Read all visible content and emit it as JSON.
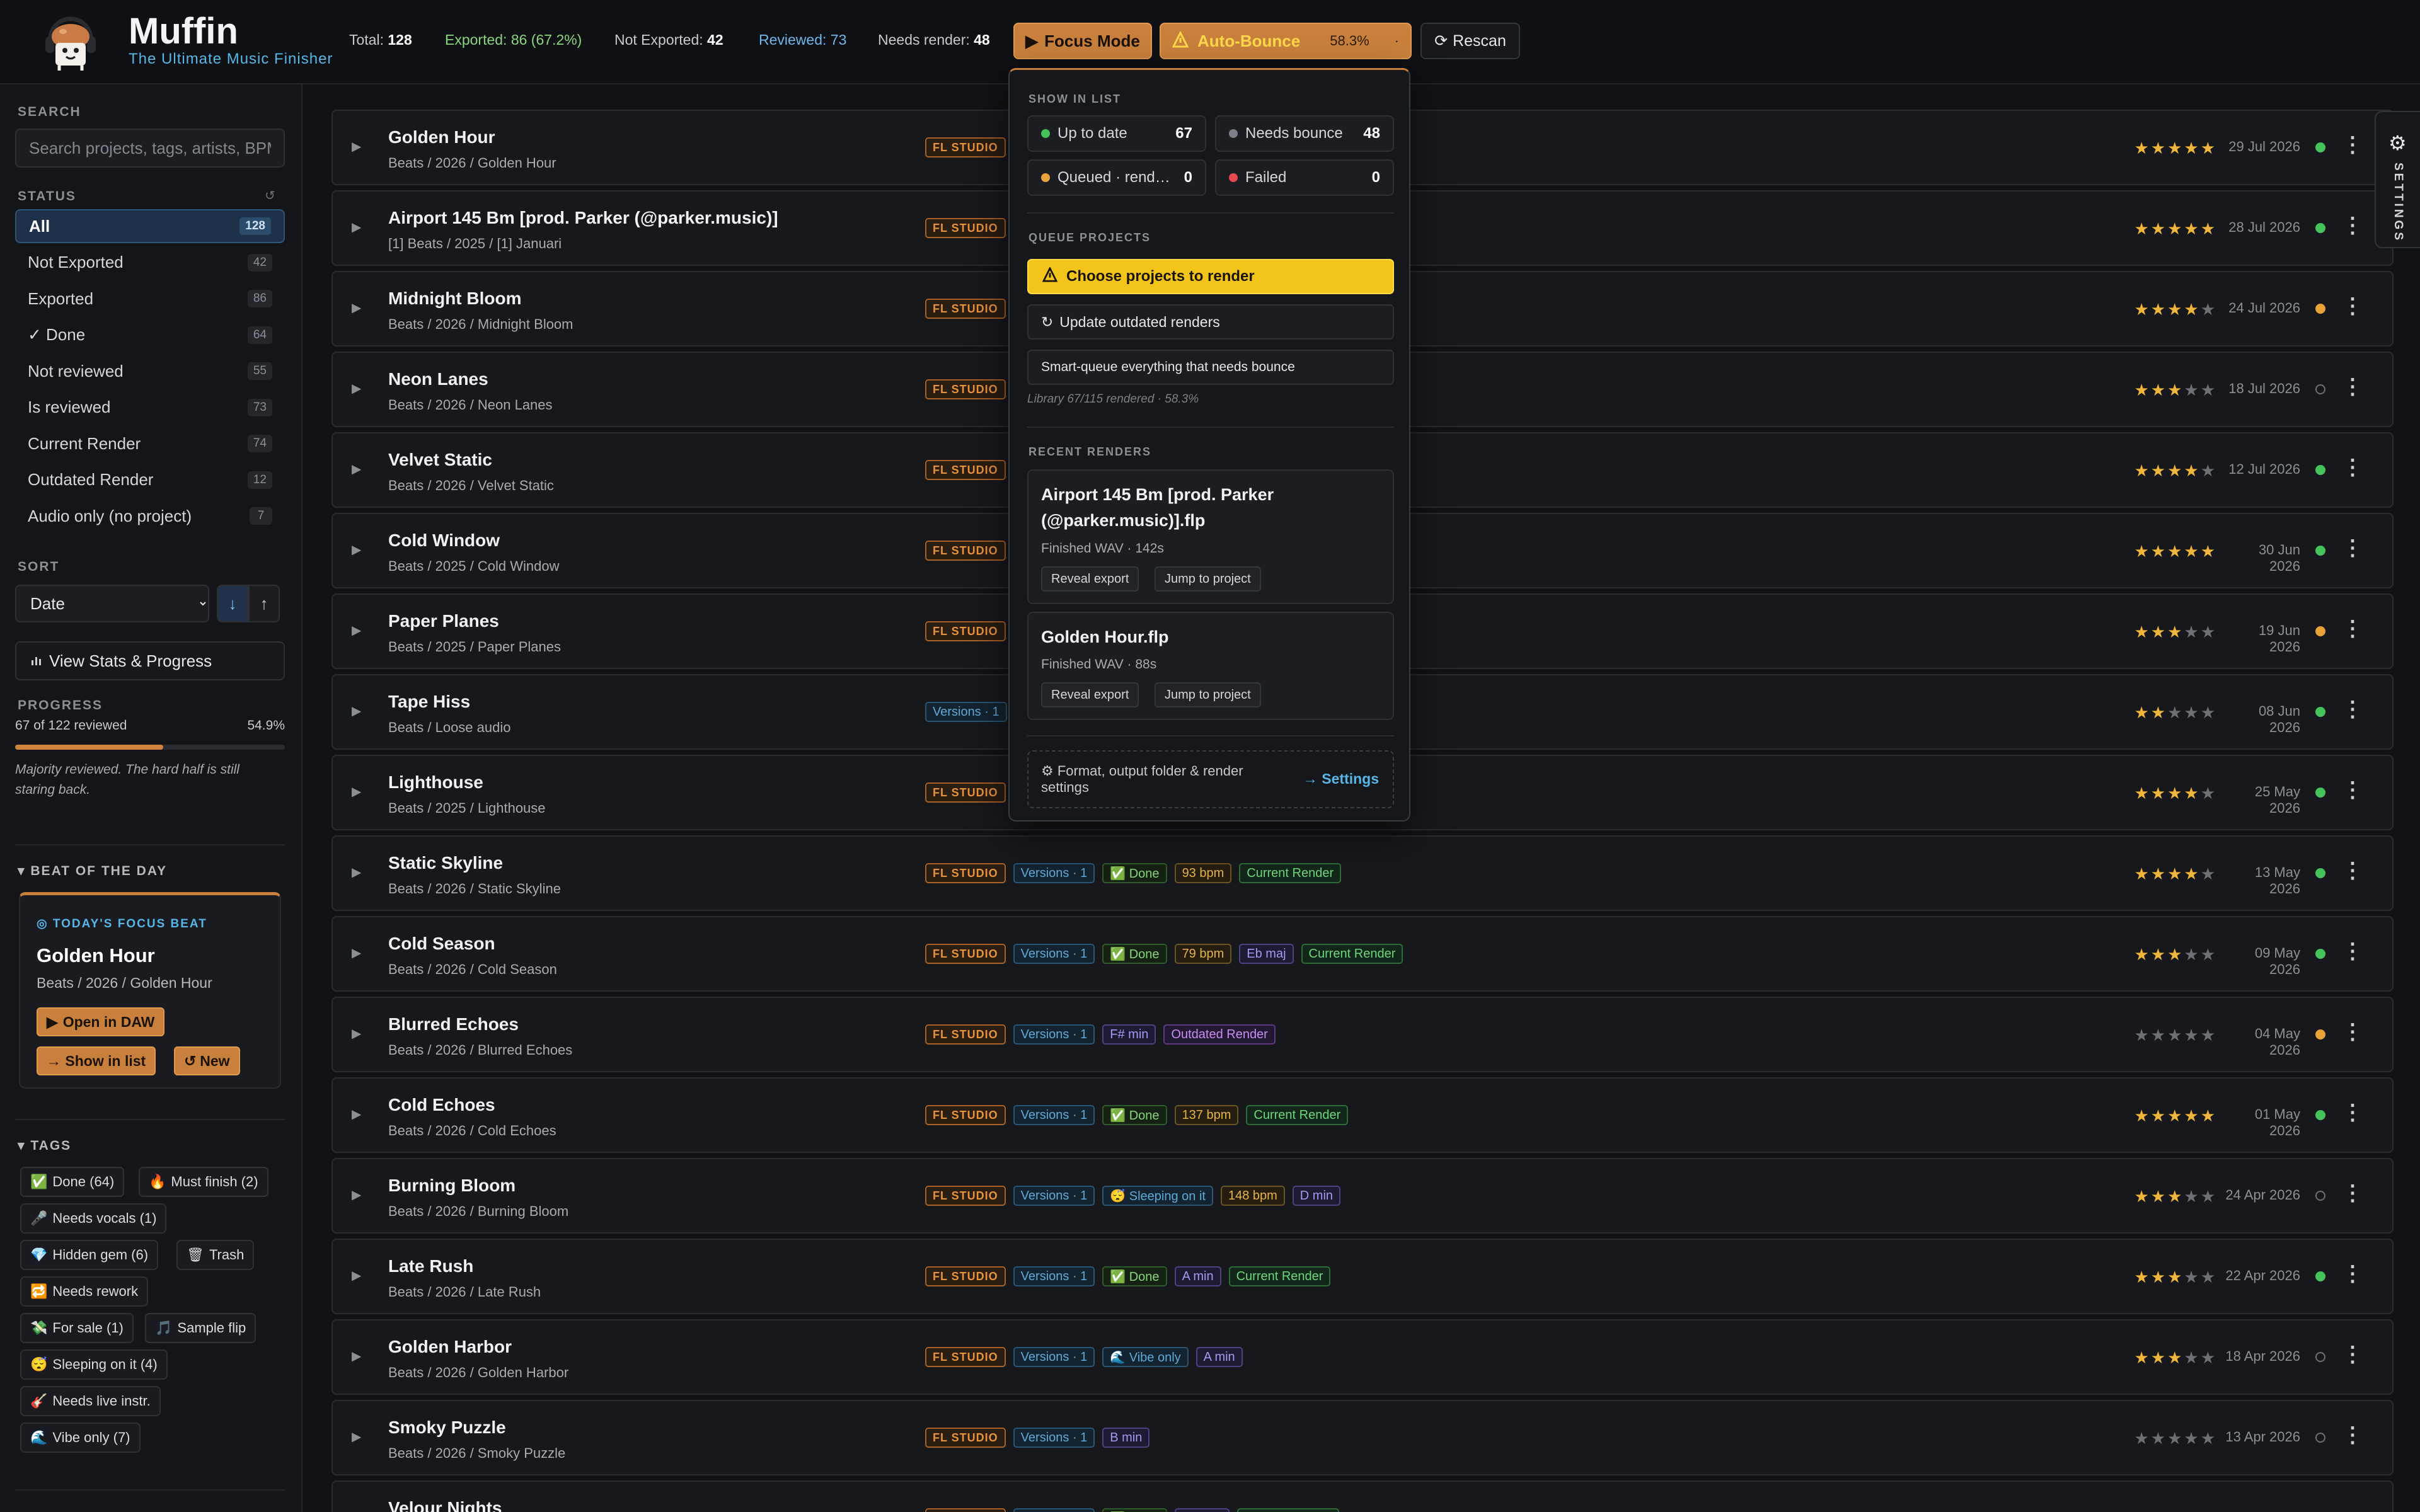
{
  "app": {
    "name": "Muffin",
    "tagline": "The Ultimate Music Finisher"
  },
  "header": {
    "stats": [
      {
        "label": "Total:",
        "value": "128",
        "tone": "default"
      },
      {
        "label": "Exported: 86 (67.2%)",
        "value": "",
        "tone": "green"
      },
      {
        "label": "Not Exported:",
        "value": "42",
        "tone": "default"
      },
      {
        "label": "Reviewed: 73",
        "value": "",
        "tone": "blue"
      },
      {
        "label": "Needs render:",
        "value": "48",
        "tone": "default"
      }
    ],
    "focus_mode_label": "Focus Mode",
    "auto_bounce_label": "Auto-Bounce",
    "auto_bounce_pct": "58.3%",
    "auto_bounce_dot": "·",
    "rescan_label": "Rescan"
  },
  "sidebar": {
    "search_label": "SEARCH",
    "search_placeholder": "Search projects, tags, artists, BPM",
    "status_label": "STATUS",
    "status_items": [
      {
        "label": "All",
        "count": "128",
        "active": true
      },
      {
        "label": "Not Exported",
        "count": "42"
      },
      {
        "label": "Exported",
        "count": "86"
      },
      {
        "label": "✓ Done",
        "count": "64"
      },
      {
        "label": "Not reviewed",
        "count": "55"
      },
      {
        "label": "Is reviewed",
        "count": "73"
      },
      {
        "label": "Current Render",
        "count": "74"
      },
      {
        "label": "Outdated Render",
        "count": "12"
      },
      {
        "label": "Audio only (no project)",
        "count": "7"
      }
    ],
    "sort_label": "SORT",
    "sort_value": "Date",
    "sort_options": [
      "Date"
    ],
    "sort_down": "↓",
    "sort_up": "↑",
    "view_stats_label": "View Stats & Progress",
    "progress_label": "PROGRESS",
    "progress_text": "67 of 122 reviewed",
    "progress_pct_text": "54.9%",
    "progress_value": 0.549,
    "progress_note": "Majority reviewed. The hard half is still staring back.",
    "beat_of_day_label": "BEAT OF THE DAY",
    "beat": {
      "focus_label": "TODAY'S FOCUS BEAT",
      "title": "Golden Hour",
      "path": "Beats / 2026 / Golden Hour",
      "open_daw": "Open in DAW",
      "show_in_list": "→ Show in list",
      "new_label": "New"
    },
    "tags_label": "TAGS",
    "tags": [
      {
        "icon": "✅",
        "label": "Done (64)"
      },
      {
        "icon": "🔥",
        "label": "Must finish (2)"
      },
      {
        "icon": "🎤",
        "label": "Needs vocals (1)"
      },
      {
        "icon": "💎",
        "label": "Hidden gem (6)"
      },
      {
        "icon": "🗑",
        "label": "Trash"
      },
      {
        "icon": "🔁",
        "label": "Needs rework"
      },
      {
        "icon": "💸",
        "label": "For sale (1)"
      },
      {
        "icon": "🎵",
        "label": "Sample flip"
      },
      {
        "icon": "😴",
        "label": "Sleeping on it (4)"
      },
      {
        "icon": "🎸",
        "label": "Needs live instr."
      },
      {
        "icon": "🌊",
        "label": "Vibe only (7)"
      }
    ]
  },
  "rows": [
    {
      "title": "Golden Hour",
      "path": "Beats / 2026 / Golden Hour",
      "chips": [
        {
          "t": "FL STUDIO",
          "k": "fl"
        }
      ],
      "stars": 5,
      "date": "29 Jul 2026",
      "dot": "green"
    },
    {
      "title": "Airport 145 Bm [prod. Parker (@parker.music)]",
      "path": "[1] Beats / 2025 / [1] Januari",
      "chips": [
        {
          "t": "FL STUDIO",
          "k": "fl"
        }
      ],
      "stars": 5,
      "date": "28 Jul 2026",
      "dot": "green"
    },
    {
      "title": "Midnight Bloom",
      "path": "Beats / 2026 / Midnight Bloom",
      "chips": [
        {
          "t": "FL STUDIO",
          "k": "fl"
        }
      ],
      "stars": 4,
      "date": "24 Jul 2026",
      "dot": "orange"
    },
    {
      "title": "Neon Lanes",
      "path": "Beats / 2026 / Neon Lanes",
      "chips": [
        {
          "t": "FL STUDIO",
          "k": "fl"
        }
      ],
      "stars": 3,
      "date": "18 Jul 2026",
      "dot": "empty"
    },
    {
      "title": "Velvet Static",
      "path": "Beats / 2026 / Velvet Static",
      "chips": [
        {
          "t": "FL STUDIO",
          "k": "fl"
        }
      ],
      "stars": 4,
      "date": "12 Jul 2026",
      "dot": "green"
    },
    {
      "title": "Cold Window",
      "path": "Beats / 2025 / Cold Window",
      "chips": [
        {
          "t": "FL STUDIO",
          "k": "fl"
        }
      ],
      "stars": 5,
      "date": "30 Jun 2026",
      "dot": "green"
    },
    {
      "title": "Paper Planes",
      "path": "Beats / 2025 / Paper Planes",
      "chips": [
        {
          "t": "FL STUDIO",
          "k": "fl"
        }
      ],
      "stars": 3,
      "date": "19 Jun 2026",
      "dot": "orange"
    },
    {
      "title": "Tape Hiss",
      "path": "Beats / Loose audio",
      "chips": [
        {
          "t": "Versions · 1",
          "k": "ver"
        }
      ],
      "stars": 2,
      "date": "08 Jun 2026",
      "dot": "green"
    },
    {
      "title": "Lighthouse",
      "path": "Beats / 2025 / Lighthouse",
      "chips": [
        {
          "t": "FL STUDIO",
          "k": "fl"
        }
      ],
      "stars": 4,
      "date": "25 May 2026",
      "dot": "green"
    },
    {
      "title": "Static Skyline",
      "path": "Beats / 2026 / Static Skyline",
      "chips": [
        {
          "t": "FL STUDIO",
          "k": "fl"
        },
        {
          "t": "Versions · 1",
          "k": "ver"
        },
        {
          "t": "✅ Done",
          "k": "done"
        },
        {
          "t": "93 bpm",
          "k": "bpm"
        },
        {
          "t": "Current Render",
          "k": "cur"
        }
      ],
      "stars": 4,
      "date": "13 May 2026",
      "dot": "green"
    },
    {
      "title": "Cold Season",
      "path": "Beats / 2026 / Cold Season",
      "chips": [
        {
          "t": "FL STUDIO",
          "k": "fl"
        },
        {
          "t": "Versions · 1",
          "k": "ver"
        },
        {
          "t": "✅ Done",
          "k": "done"
        },
        {
          "t": "79 bpm",
          "k": "bpm"
        },
        {
          "t": "Eb maj",
          "k": "key"
        },
        {
          "t": "Current Render",
          "k": "cur"
        }
      ],
      "stars": 3,
      "date": "09 May 2026",
      "dot": "green"
    },
    {
      "title": "Blurred Echoes",
      "path": "Beats / 2026 / Blurred Echoes",
      "chips": [
        {
          "t": "FL STUDIO",
          "k": "fl"
        },
        {
          "t": "Versions · 1",
          "k": "ver"
        },
        {
          "t": "F# min",
          "k": "key"
        },
        {
          "t": "Outdated Render",
          "k": "out"
        }
      ],
      "stars": 0,
      "date": "04 May 2026",
      "dot": "orange"
    },
    {
      "title": "Cold Echoes",
      "path": "Beats / 2026 / Cold Echoes",
      "chips": [
        {
          "t": "FL STUDIO",
          "k": "fl"
        },
        {
          "t": "Versions · 1",
          "k": "ver"
        },
        {
          "t": "✅ Done",
          "k": "done"
        },
        {
          "t": "137 bpm",
          "k": "bpm"
        },
        {
          "t": "Current Render",
          "k": "cur"
        }
      ],
      "stars": 5,
      "date": "01 May 2026",
      "dot": "green"
    },
    {
      "title": "Burning Bloom",
      "path": "Beats / 2026 / Burning Bloom",
      "chips": [
        {
          "t": "FL STUDIO",
          "k": "fl"
        },
        {
          "t": "Versions · 1",
          "k": "ver"
        },
        {
          "t": "😴 Sleeping on it",
          "k": "sleep"
        },
        {
          "t": "148 bpm",
          "k": "bpm"
        },
        {
          "t": "D min",
          "k": "key"
        }
      ],
      "stars": 3,
      "date": "24 Apr 2026",
      "dot": "empty"
    },
    {
      "title": "Late Rush",
      "path": "Beats / 2026 / Late Rush",
      "chips": [
        {
          "t": "FL STUDIO",
          "k": "fl"
        },
        {
          "t": "Versions · 1",
          "k": "ver"
        },
        {
          "t": "✅ Done",
          "k": "done"
        },
        {
          "t": "A min",
          "k": "key"
        },
        {
          "t": "Current Render",
          "k": "cur"
        }
      ],
      "stars": 3,
      "date": "22 Apr 2026",
      "dot": "green"
    },
    {
      "title": "Golden Harbor",
      "path": "Beats / 2026 / Golden Harbor",
      "chips": [
        {
          "t": "FL STUDIO",
          "k": "fl"
        },
        {
          "t": "Versions · 1",
          "k": "ver"
        },
        {
          "t": "🌊 Vibe only",
          "k": "vibe"
        },
        {
          "t": "A min",
          "k": "key"
        }
      ],
      "stars": 3,
      "date": "18 Apr 2026",
      "dot": "empty"
    },
    {
      "title": "Smoky Puzzle",
      "path": "Beats / 2026 / Smoky Puzzle",
      "chips": [
        {
          "t": "FL STUDIO",
          "k": "fl"
        },
        {
          "t": "Versions · 1",
          "k": "ver"
        },
        {
          "t": "B min",
          "k": "key"
        }
      ],
      "stars": 0,
      "date": "13 Apr 2026",
      "dot": "empty"
    },
    {
      "title": "Velour Nights",
      "path": "",
      "chips": [
        {
          "t": "FL STUDIO",
          "k": "fl"
        },
        {
          "t": "Versions · 1",
          "k": "ver"
        },
        {
          "t": "✅ Done",
          "k": "done"
        },
        {
          "t": "C# min",
          "k": "key"
        },
        {
          "t": "Current Render",
          "k": "cur"
        }
      ],
      "stars": 0,
      "date": "",
      "dot": ""
    }
  ],
  "settings_tab_label": "SETTINGS",
  "dropdown": {
    "show_in_list_label": "SHOW IN LIST",
    "stats": [
      {
        "label": "Up to date",
        "value": "67",
        "color": "#46c25a"
      },
      {
        "label": "Needs bounce",
        "value": "48",
        "color": "#7d7f86"
      },
      {
        "label": "Queued · rendering",
        "value": "0",
        "color": "#e8a23a"
      },
      {
        "label": "Failed",
        "value": "0",
        "color": "#e5484d"
      }
    ],
    "queue_label": "QUEUE PROJECTS",
    "choose_label": "Choose projects to render",
    "update_label": "Update outdated renders",
    "smart_label": "Smart-queue everything that needs bounce",
    "library_note": "Library 67/115 rendered · 58.3%",
    "recent_label": "RECENT RENDERS",
    "recent": [
      {
        "title": "Airport 145 Bm [prod. Parker (@parker.music)].flp",
        "meta": "Finished   WAV · 142s",
        "reveal": "Reveal export",
        "jump": "Jump to project"
      },
      {
        "title": "Golden Hour.flp",
        "meta": "Finished   WAV · 88s",
        "reveal": "Reveal export",
        "jump": "Jump to project"
      }
    ],
    "footer_text": "Format, output folder & render settings",
    "footer_link": "→ Settings"
  },
  "colors": {
    "accent": "#c9803d",
    "accent_border": "#e09a4d",
    "primary_yellow": "#f3c51a",
    "link_blue": "#57b6e6",
    "bg": "#111215"
  }
}
